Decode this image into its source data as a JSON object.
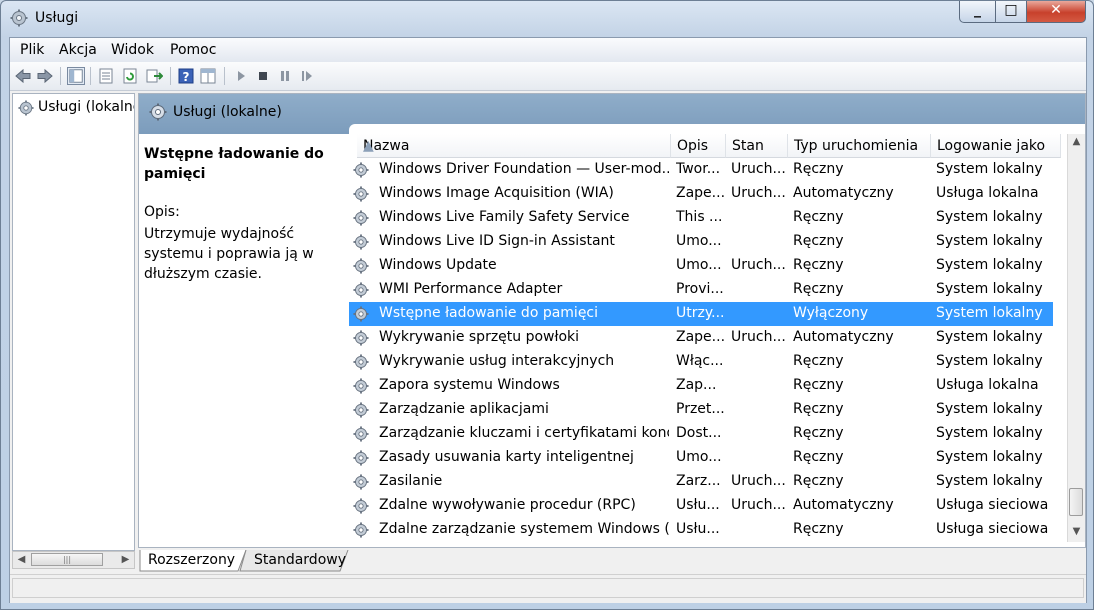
{
  "window": {
    "title": "Usługi"
  },
  "menu": [
    "Plik",
    "Akcja",
    "Widok",
    "Pomoc"
  ],
  "tree": {
    "item": "Usługi (lokalne"
  },
  "panel": {
    "header": "Usługi (lokalne)"
  },
  "description": {
    "title": "Wstępne ładowanie do pamięci",
    "label": "Opis:",
    "text": "Utrzymuje wydajność systemu i poprawia ją w dłuższym czasie."
  },
  "columns": [
    "Nazwa",
    "Opis",
    "Stan",
    "Typ uruchomienia",
    "Logowanie jako"
  ],
  "rows": [
    {
      "name": "Windows Driver Foundation — User-mod...",
      "desc": "Twor...",
      "status": "Uruch...",
      "startup": "Ręczny",
      "logon": "System lokalny"
    },
    {
      "name": "Windows Image Acquisition (WIA)",
      "desc": "Zape...",
      "status": "Uruch...",
      "startup": "Automatyczny",
      "logon": "Usługa lokalna"
    },
    {
      "name": "Windows Live Family Safety Service",
      "desc": "This ...",
      "status": "",
      "startup": "Ręczny",
      "logon": "System lokalny"
    },
    {
      "name": "Windows Live ID Sign-in Assistant",
      "desc": "Umo...",
      "status": "",
      "startup": "Ręczny",
      "logon": "System lokalny"
    },
    {
      "name": "Windows Update",
      "desc": "Umo...",
      "status": "Uruch...",
      "startup": "Ręczny",
      "logon": "System lokalny"
    },
    {
      "name": "WMI Performance Adapter",
      "desc": "Provi...",
      "status": "",
      "startup": "Ręczny",
      "logon": "System lokalny"
    },
    {
      "name": "Wstępne ładowanie do pamięci",
      "desc": "Utrzy...",
      "status": "",
      "startup": "Wyłączony",
      "logon": "System lokalny",
      "selected": true
    },
    {
      "name": "Wykrywanie sprzętu powłoki",
      "desc": "Zape...",
      "status": "Uruch...",
      "startup": "Automatyczny",
      "logon": "System lokalny"
    },
    {
      "name": "Wykrywanie usług interakcyjnych",
      "desc": "Włąc...",
      "status": "",
      "startup": "Ręczny",
      "logon": "System lokalny"
    },
    {
      "name": "Zapora systemu Windows",
      "desc": "Zap...",
      "status": "",
      "startup": "Ręczny",
      "logon": "Usługa lokalna"
    },
    {
      "name": "Zarządzanie aplikacjami",
      "desc": "Przet...",
      "status": "",
      "startup": "Ręczny",
      "logon": "System lokalny"
    },
    {
      "name": "Zarządzanie kluczami i certyfikatami kond...",
      "desc": "Dost...",
      "status": "",
      "startup": "Ręczny",
      "logon": "System lokalny"
    },
    {
      "name": "Zasady usuwania karty inteligentnej",
      "desc": "Umo...",
      "status": "",
      "startup": "Ręczny",
      "logon": "System lokalny"
    },
    {
      "name": "Zasilanie",
      "desc": "Zarz...",
      "status": "Uruch...",
      "startup": "Ręczny",
      "logon": "System lokalny"
    },
    {
      "name": "Zdalne wywoływanie procedur (RPC)",
      "desc": "Usłu...",
      "status": "Uruch...",
      "startup": "Automatyczny",
      "logon": "Usługa sieciowa"
    },
    {
      "name": "Zdalne zarządzanie systemem Windows (...",
      "desc": "Usłu...",
      "status": "",
      "startup": "Ręczny",
      "logon": "Usługa sieciowa"
    }
  ],
  "tabs": [
    "Rozszerzony",
    "Standardowy"
  ],
  "icons": {
    "title": "gear-icon",
    "service": "gear-icon",
    "toolbar": [
      "back-arrow-icon",
      "forward-arrow-icon",
      "show-tree-icon",
      "properties-icon",
      "refresh-icon",
      "export-icon",
      "help-icon",
      "view-icon",
      "start-icon",
      "stop-icon",
      "pause-icon",
      "restart-icon"
    ]
  }
}
